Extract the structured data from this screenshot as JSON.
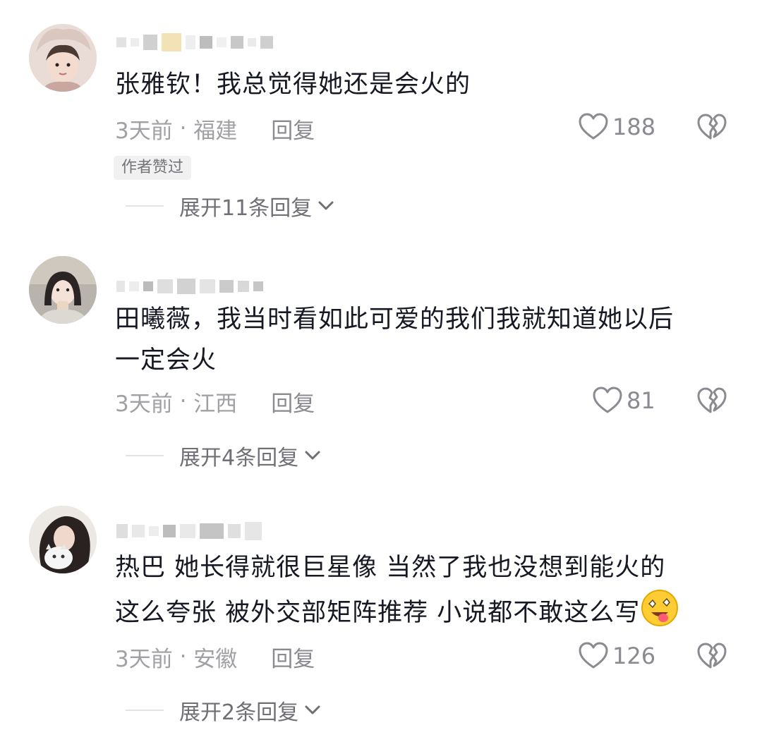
{
  "comments": [
    {
      "text": "张雅钦！我总觉得她还是会火的",
      "time": "3天前",
      "sep": " · ",
      "location": "福建",
      "reply_label": "回复",
      "likes": "188",
      "badge": "作者赞过",
      "expand_label": "展开11条回复"
    },
    {
      "text_line1": "田曦薇，我当时看如此可爱的我们我就知道她以后",
      "text_line2": "一定会火",
      "time": "3天前",
      "sep": " · ",
      "location": "江西",
      "reply_label": "回复",
      "likes": "81",
      "expand_label": "展开4条回复"
    },
    {
      "text_line1": "热巴 她长得就很巨星像 当然了我也没想到能火的",
      "text_line2": "这么夸张 被外交部矩阵推荐 小说都不敢这么写",
      "time": "3天前",
      "sep": " · ",
      "location": "安徽",
      "reply_label": "回复",
      "likes": "126",
      "expand_label": "展开2条回复",
      "emoji": "drooling-face-emoji"
    }
  ],
  "icons": {
    "like": "heart-outline-icon",
    "dislike": "broken-heart-icon",
    "expand": "chevron-down-icon"
  },
  "colors": {
    "text": "#161823",
    "meta": "#a0a0a5",
    "icon": "#8a8a90"
  }
}
